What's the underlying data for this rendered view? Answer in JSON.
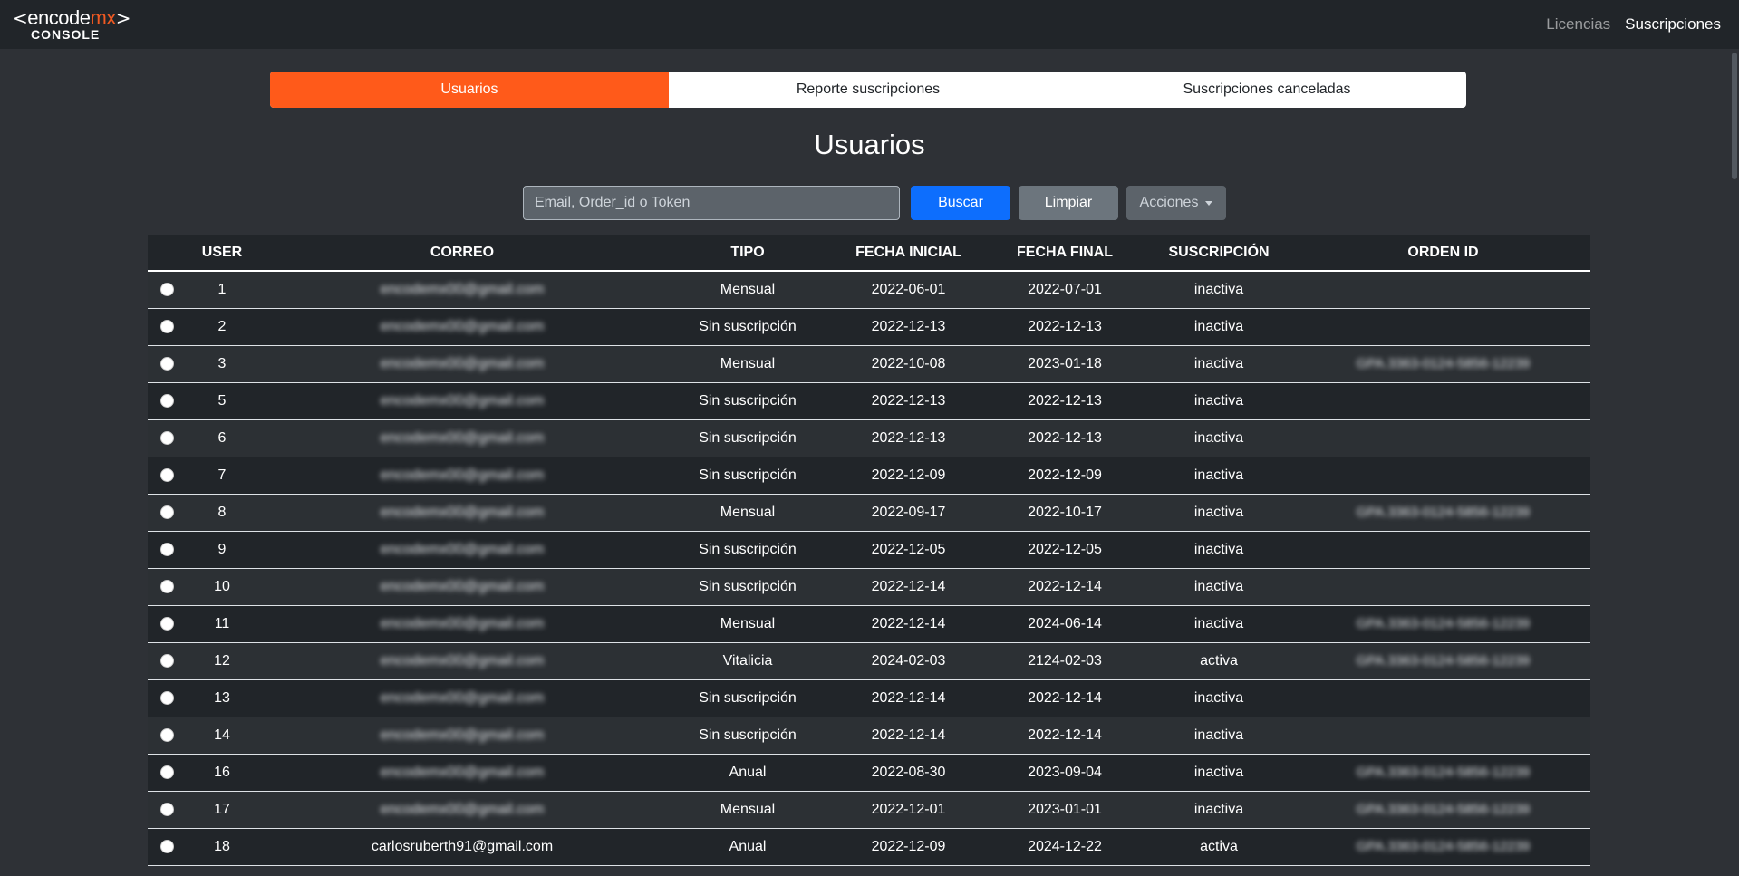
{
  "brand": {
    "left_bracket": "<",
    "encode": "encode",
    "mx": "mx",
    "right_bracket": ">",
    "console": "CONSOLE"
  },
  "nav": {
    "licencias": "Licencias",
    "suscripciones": "Suscripciones"
  },
  "tabs": [
    {
      "label": "Usuarios",
      "active": true
    },
    {
      "label": "Reporte suscripciones",
      "active": false
    },
    {
      "label": "Suscripciones canceladas",
      "active": false
    }
  ],
  "page_title": "Usuarios",
  "search": {
    "placeholder": "Email, Order_id o Token",
    "value": ""
  },
  "buttons": {
    "buscar": "Buscar",
    "limpiar": "Limpiar",
    "acciones": "Acciones"
  },
  "table": {
    "headers": [
      "USER",
      "CORREO",
      "TIPO",
      "FECHA INICIAL",
      "FECHA FINAL",
      "SUSCRIPCIÓN",
      "ORDEN ID"
    ],
    "rows": [
      {
        "user": "1",
        "correo": "encodemx00@gmail.com",
        "tipo": "Mensual",
        "inicio": "2022-06-01",
        "fin": "2022-07-01",
        "estado": "inactiva",
        "orden": ""
      },
      {
        "user": "2",
        "correo": "encodemx00@gmail.com",
        "tipo": "Sin suscripción",
        "inicio": "2022-12-13",
        "fin": "2022-12-13",
        "estado": "inactiva",
        "orden": ""
      },
      {
        "user": "3",
        "correo": "encodemx00@gmail.com",
        "tipo": "Mensual",
        "inicio": "2022-10-08",
        "fin": "2023-01-18",
        "estado": "inactiva",
        "orden": "GPA.3363-0124-5856-12239"
      },
      {
        "user": "5",
        "correo": "encodemx00@gmail.com",
        "tipo": "Sin suscripción",
        "inicio": "2022-12-13",
        "fin": "2022-12-13",
        "estado": "inactiva",
        "orden": ""
      },
      {
        "user": "6",
        "correo": "encodemx00@gmail.com",
        "tipo": "Sin suscripción",
        "inicio": "2022-12-13",
        "fin": "2022-12-13",
        "estado": "inactiva",
        "orden": ""
      },
      {
        "user": "7",
        "correo": "encodemx00@gmail.com",
        "tipo": "Sin suscripción",
        "inicio": "2022-12-09",
        "fin": "2022-12-09",
        "estado": "inactiva",
        "orden": ""
      },
      {
        "user": "8",
        "correo": "encodemx00@gmail.com",
        "tipo": "Mensual",
        "inicio": "2022-09-17",
        "fin": "2022-10-17",
        "estado": "inactiva",
        "orden": "GPA.3363-0124-5856-12239"
      },
      {
        "user": "9",
        "correo": "encodemx00@gmail.com",
        "tipo": "Sin suscripción",
        "inicio": "2022-12-05",
        "fin": "2022-12-05",
        "estado": "inactiva",
        "orden": ""
      },
      {
        "user": "10",
        "correo": "encodemx00@gmail.com",
        "tipo": "Sin suscripción",
        "inicio": "2022-12-14",
        "fin": "2022-12-14",
        "estado": "inactiva",
        "orden": ""
      },
      {
        "user": "11",
        "correo": "encodemx00@gmail.com",
        "tipo": "Mensual",
        "inicio": "2022-12-14",
        "fin": "2024-06-14",
        "estado": "inactiva",
        "orden": "GPA.3363-0124-5856-12239"
      },
      {
        "user": "12",
        "correo": "encodemx00@gmail.com",
        "tipo": "Vitalicia",
        "inicio": "2024-02-03",
        "fin": "2124-02-03",
        "estado": "activa",
        "orden": "GPA.3363-0124-5856-12239"
      },
      {
        "user": "13",
        "correo": "encodemx00@gmail.com",
        "tipo": "Sin suscripción",
        "inicio": "2022-12-14",
        "fin": "2022-12-14",
        "estado": "inactiva",
        "orden": ""
      },
      {
        "user": "14",
        "correo": "encodemx00@gmail.com",
        "tipo": "Sin suscripción",
        "inicio": "2022-12-14",
        "fin": "2022-12-14",
        "estado": "inactiva",
        "orden": ""
      },
      {
        "user": "16",
        "correo": "encodemx00@gmail.com",
        "tipo": "Anual",
        "inicio": "2022-08-30",
        "fin": "2023-09-04",
        "estado": "inactiva",
        "orden": "GPA.3363-0124-5856-12239"
      },
      {
        "user": "17",
        "correo": "encodemx00@gmail.com",
        "tipo": "Mensual",
        "inicio": "2022-12-01",
        "fin": "2023-01-01",
        "estado": "inactiva",
        "orden": "GPA.3363-0124-5856-12239"
      },
      {
        "user": "18",
        "correo": "carlosruberth91@gmail.com",
        "tipo": "Anual",
        "inicio": "2022-12-09",
        "fin": "2024-12-22",
        "estado": "activa",
        "orden": "GPA.3363-0124-5856-12239"
      }
    ]
  },
  "colors": {
    "accent": "#ff5a1a",
    "primary": "#0d6efd",
    "background": "#2e3136",
    "navbar": "#212529"
  }
}
